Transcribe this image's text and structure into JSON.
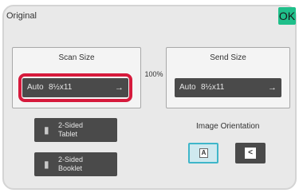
{
  "header": {
    "title": "Original",
    "ok_label": "OK"
  },
  "scan": {
    "title": "Scan Size",
    "mode": "Auto",
    "size": "8½x11",
    "arrow": "→"
  },
  "ratio": "100%",
  "send": {
    "title": "Send Size",
    "mode": "Auto",
    "size": "8½x11",
    "arrow": "→"
  },
  "two_sided": {
    "tablet_line1": "2-Sided",
    "tablet_line2": "Tablet",
    "booklet_line1": "2-Sided",
    "booklet_line2": "Booklet"
  },
  "orientation": {
    "label": "Image Orientation",
    "portrait_glyph": "A",
    "landscape_glyph": "<",
    "selected": "portrait"
  },
  "colors": {
    "accent": "#1fbf8a",
    "highlight": "#d61a3c",
    "selected": "#3fb6c9"
  },
  "icons": [
    "arrow-right-icon",
    "tablet-icon",
    "booklet-icon",
    "orientation-portrait-icon",
    "orientation-landscape-icon"
  ]
}
